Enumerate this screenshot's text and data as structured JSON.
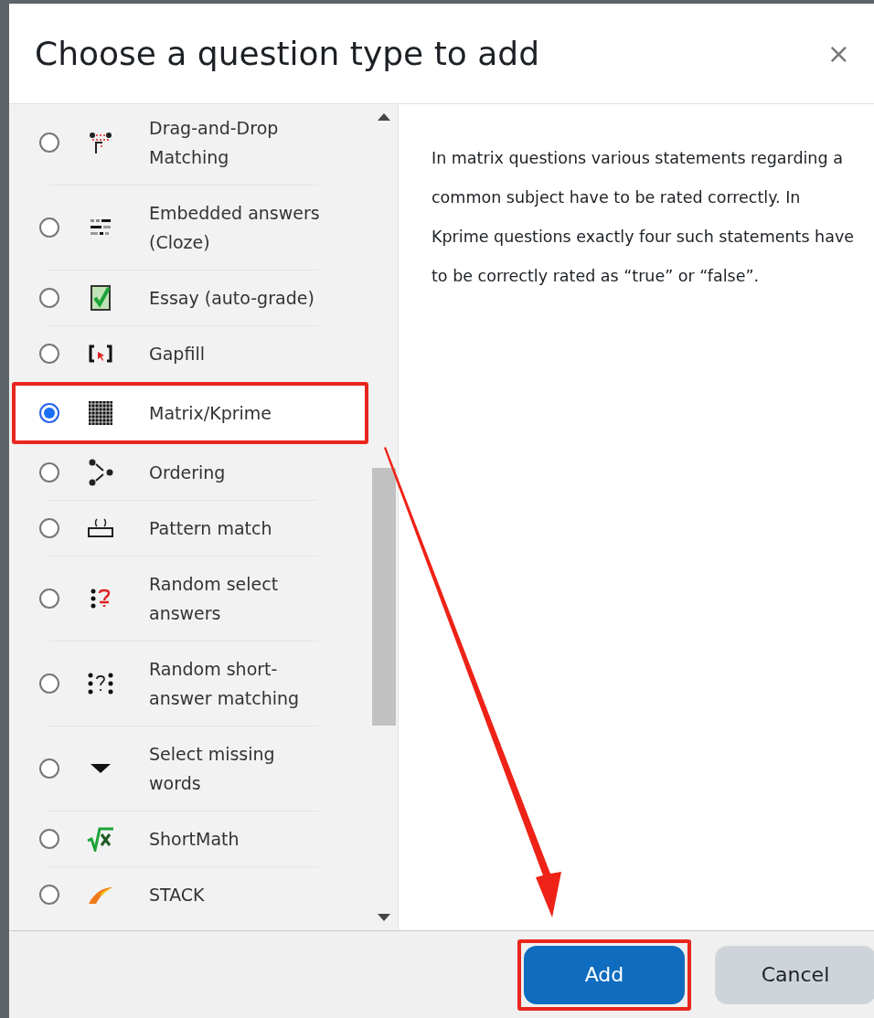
{
  "dialog": {
    "title": "Choose a question type to add",
    "close": "×"
  },
  "question_types": [
    {
      "label": "Drag-and-Drop Matching",
      "selected": false,
      "highlighted": false
    },
    {
      "label": "Embedded answers (Cloze)",
      "selected": false,
      "highlighted": false
    },
    {
      "label": "Essay (auto-grade)",
      "selected": false,
      "highlighted": false
    },
    {
      "label": "Gapfill",
      "selected": false,
      "highlighted": false
    },
    {
      "label": "Matrix/Kprime",
      "selected": true,
      "highlighted": true
    },
    {
      "label": "Ordering",
      "selected": false,
      "highlighted": false
    },
    {
      "label": "Pattern match",
      "selected": false,
      "highlighted": false
    },
    {
      "label": "Random select answers",
      "selected": false,
      "highlighted": false
    },
    {
      "label": "Random short-answer matching",
      "selected": false,
      "highlighted": false
    },
    {
      "label": "Select missing words",
      "selected": false,
      "highlighted": false
    },
    {
      "label": "ShortMath",
      "selected": false,
      "highlighted": false
    },
    {
      "label": "STACK",
      "selected": false,
      "highlighted": false
    }
  ],
  "description": "In matrix questions various statements regarding a common subject have to be rated correctly. In Kprime questions exactly four such statements have to be correctly rated as “true” or “false”.",
  "buttons": [
    {
      "label": "Add",
      "kind": "primary",
      "highlighted": true
    },
    {
      "label": "Cancel",
      "kind": "secondary",
      "highlighted": false
    }
  ]
}
